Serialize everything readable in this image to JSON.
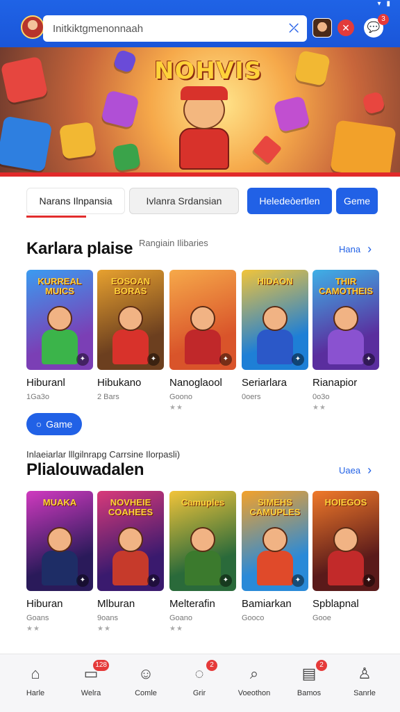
{
  "header": {
    "search_value": "Initkiktgmenonnaah",
    "chat_badge": "3"
  },
  "banner": {
    "title": "NOHVIS"
  },
  "tabs": [
    {
      "label": "Narans Ilnpansia",
      "active": true
    },
    {
      "label": "Ivlanra Srdansian",
      "active": false
    },
    {
      "label": "Heledeòertlen",
      "active": false
    },
    {
      "label": "Geme",
      "active": false
    }
  ],
  "section1": {
    "title": "Karlara plaise",
    "subtitle": "Rangiain Ilibaries",
    "see_all": "Hana",
    "button": "Game",
    "cards": [
      {
        "title": "Hiburanl",
        "meta": "1Ga3o",
        "stars": "",
        "logo": "KURREAL MUICS",
        "bg": "#7b3fb5",
        "accent": "#3b9bf0",
        "torso": "#3bb44a"
      },
      {
        "title": "Hibukano",
        "meta": "2 Bars",
        "stars": "",
        "logo": "EOSOAN BORAS",
        "bg": "#6c3f1f",
        "accent": "#e7a12f",
        "torso": "#d8322b"
      },
      {
        "title": "Nanoglaool",
        "meta": "Goono",
        "stars": "★★",
        "logo": "",
        "bg": "#d9542a",
        "accent": "#f6a94a",
        "torso": "#c0282a"
      },
      {
        "title": "Seriarlara",
        "meta": "0oers",
        "stars": "",
        "logo": "HIDAON",
        "bg": "#1e7fd6",
        "accent": "#f1c43a",
        "torso": "#2b58c8"
      },
      {
        "title": "Rianapior",
        "meta": "0o3o",
        "stars": "★★",
        "logo": "THIR CAMOTHEIS",
        "bg": "#5a2e9e",
        "accent": "#3fb0e6",
        "torso": "#8a52d0"
      }
    ]
  },
  "section2": {
    "subtitle": "Inlaeiarlar lllgilnrapg Carrsine Ilorpasli)",
    "title": "Plialouwadalen",
    "see_all": "Uaea",
    "cards": [
      {
        "title": "Hiburan",
        "meta": "Goans",
        "stars": "★★",
        "logo": "MUAKA",
        "bg": "#2a1a5a",
        "accent": "#d03abf",
        "torso": "#1e2d66"
      },
      {
        "title": "Mlburan",
        "meta": "9oans",
        "stars": "★★",
        "logo": "NOVHEIE COAHEES",
        "bg": "#3a1a6e",
        "accent": "#d83a7a",
        "torso": "#c63a2b"
      },
      {
        "title": "Melterafin",
        "meta": "Goano",
        "stars": "★★",
        "logo": "Camuples",
        "bg": "#2a6a3a",
        "accent": "#f2c43a",
        "torso": "#3b7a2d"
      },
      {
        "title": "Bamiarkan",
        "meta": "Gooco",
        "stars": "",
        "logo": "SIMEHS CAMUPLES",
        "bg": "#2a8ad8",
        "accent": "#f3a12a",
        "torso": "#e04a2a"
      },
      {
        "title": "Spblapnal",
        "meta": "Gooe",
        "stars": "",
        "logo": "HOIEGOS",
        "bg": "#5a1a1a",
        "accent": "#f07a2a",
        "torso": "#c22a2a"
      }
    ]
  },
  "bottom_nav": [
    {
      "label": "Harle",
      "icon": "home-icon",
      "badge": ""
    },
    {
      "label": "Welra",
      "icon": "wallet-icon",
      "badge": "128"
    },
    {
      "label": "Comle",
      "icon": "gamepad-icon",
      "badge": ""
    },
    {
      "label": "Grir",
      "icon": "chat-icon",
      "badge": "2"
    },
    {
      "label": "Voeothon",
      "icon": "search-icon",
      "badge": ""
    },
    {
      "label": "Bamos",
      "icon": "news-icon",
      "badge": "2"
    },
    {
      "label": "Sanrle",
      "icon": "user-icon",
      "badge": ""
    }
  ],
  "colors": {
    "primary": "#2161e6",
    "accent_red": "#e22d2d"
  }
}
